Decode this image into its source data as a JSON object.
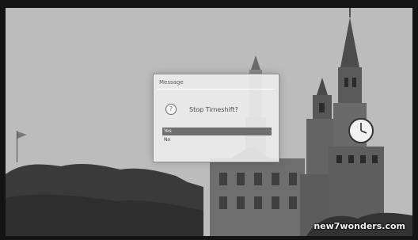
{
  "dialog": {
    "title": "Message",
    "question": "Stop Timeshift?",
    "options": [
      "Yes",
      "No"
    ],
    "selected": "Yes"
  },
  "watermark": "new7wonders.com",
  "icons": {
    "dialog": "question-icon"
  },
  "colors": {
    "selection": "#6f6f6f",
    "frame": "#141414"
  }
}
